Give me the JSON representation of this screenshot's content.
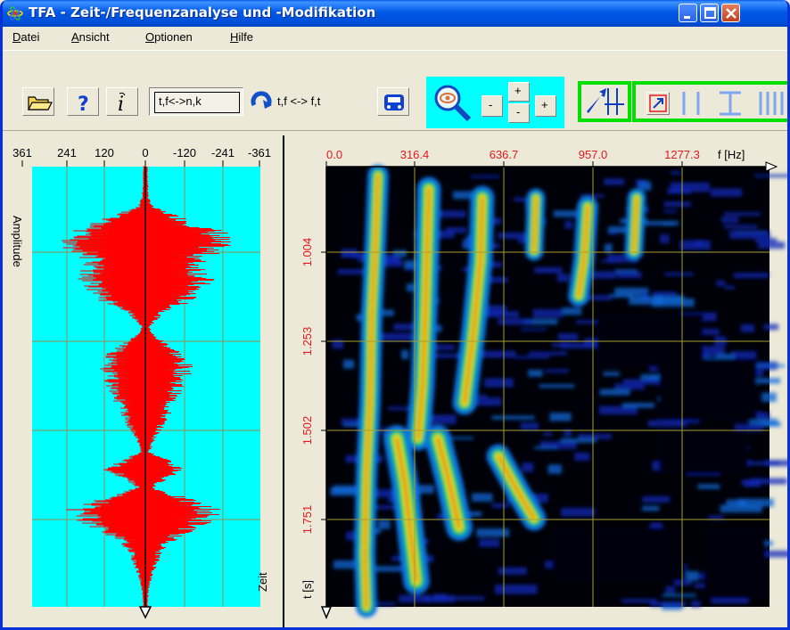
{
  "window": {
    "title": "TFA - Zeit-/Frequenzanalyse und -Modifikation",
    "minimize_icon": "minimize-icon",
    "maximize_icon": "maximize-icon",
    "close_icon": "close-icon"
  },
  "menu": {
    "items": [
      {
        "accel": "D",
        "rest": "atei"
      },
      {
        "accel": "A",
        "rest": "nsicht"
      },
      {
        "accel": "O",
        "rest": "ptionen"
      },
      {
        "accel": "H",
        "rest": "ilfe"
      }
    ]
  },
  "toolbar": {
    "open_icon": "folder-open-icon",
    "help_icon": "question-icon",
    "info_icon": "info-icon",
    "tf_nk_label": "t,f<->n,k",
    "swap_label": "t,f <-> f,t",
    "swap_icon": "rotate-icon",
    "car_icon": "car-icon",
    "zoom_icon": "magnifier-icon",
    "zoom_minus": "-",
    "zoom_plus": "+",
    "zoom_up_plus": "+",
    "zoom_down_minus": "-",
    "cursor_icon": "cursor-bars-icon",
    "arrow_icon": "arrow-icon",
    "vbars_icon": "vertical-bars-icon",
    "hbars_icon": "horizontal-bars-icon",
    "multibars_icon": "multi-bars-icon"
  },
  "waveform": {
    "amp_ticks": [
      "361",
      "241",
      "120",
      "0",
      "-120",
      "-241",
      "-361"
    ],
    "amplitude_label": "Amplitude",
    "zeit_label": "Zeit",
    "background": "#00FFFF",
    "signal_color": "#FF0000",
    "grid_color": "#9A8E50"
  },
  "spectrogram": {
    "freq_ticks": [
      "0.0",
      "316.4",
      "636.7",
      "957.0",
      "1277.3"
    ],
    "freq_unit": "f [Hz]",
    "time_ticks": [
      "1.004",
      "1.253",
      "1.502",
      "1.751"
    ],
    "time_unit": "t [s]",
    "tick_color": "#E8181E",
    "grid_color": "#A8A030"
  }
}
